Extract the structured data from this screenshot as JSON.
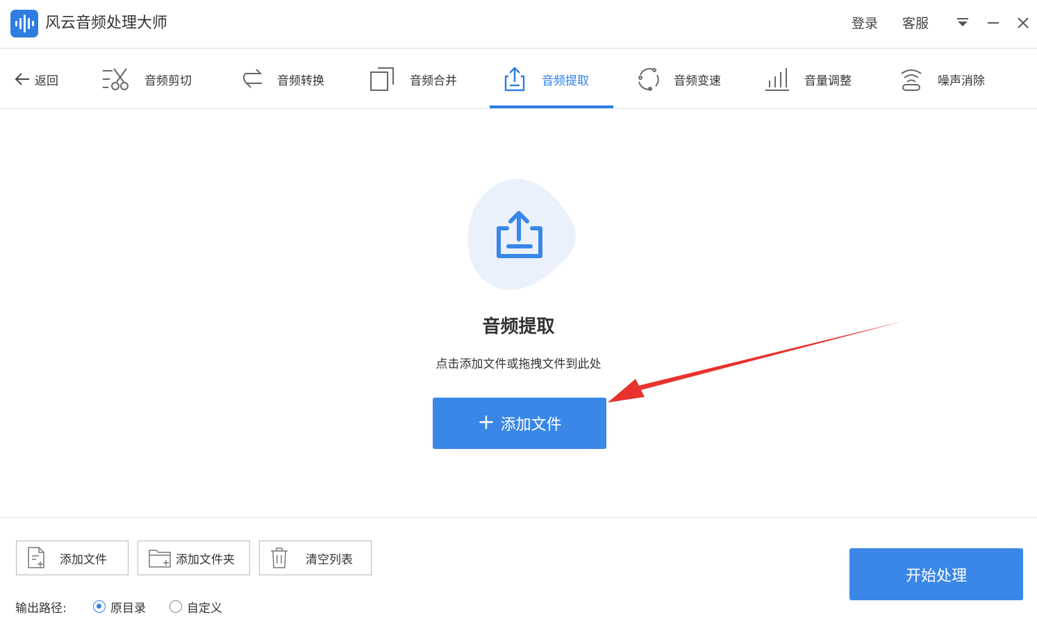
{
  "app": {
    "title": "风云音频处理大师",
    "login": "登录",
    "service": "客服"
  },
  "toolbar": {
    "back_label": "返回",
    "tabs": [
      {
        "label": "音频剪切",
        "icon": "scissors-icon",
        "active": false
      },
      {
        "label": "音频转换",
        "icon": "convert-arrows-icon",
        "active": false
      },
      {
        "label": "音频合并",
        "icon": "merge-squares-icon",
        "active": false
      },
      {
        "label": "音频提取",
        "icon": "upload-tray-icon",
        "active": true
      },
      {
        "label": "音频变速",
        "icon": "speed-circle-icon",
        "active": false
      },
      {
        "label": "音量调整",
        "icon": "volume-bars-icon",
        "active": false
      },
      {
        "label": "噪声消除",
        "icon": "noise-wifi-icon",
        "active": false
      }
    ]
  },
  "drop_area": {
    "title": "音频提取",
    "subtitle": "点击添加文件或拖拽文件到此处",
    "add_button": "添加文件",
    "add_button_plus": "+"
  },
  "bottom": {
    "add_file": "添加文件",
    "add_folder": "添加文件夹",
    "clear_list": "清空列表",
    "start": "开始处理",
    "output_label": "输出路径:",
    "output_options": [
      {
        "label": "原目录",
        "checked": true
      },
      {
        "label": "自定义",
        "checked": false
      }
    ]
  },
  "colors": {
    "accent": "#2d7ee5",
    "button": "#3a87e8",
    "blob": "#eaf1fb",
    "annotation_arrow": "#e8322e"
  }
}
